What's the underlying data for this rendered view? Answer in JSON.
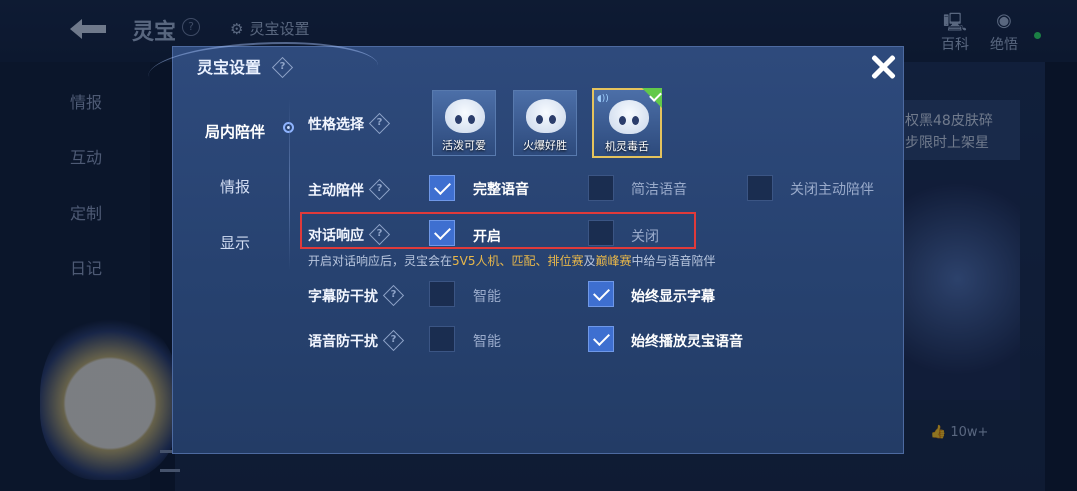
{
  "background": {
    "title": "灵宝",
    "help": "?",
    "settings_link": "灵宝设置",
    "right_buttons": [
      {
        "label": "百科",
        "icon": "computer-icon"
      },
      {
        "label": "绝悟",
        "icon": "wisdom-icon"
      }
    ],
    "sidebar": [
      "情报",
      "互动",
      "定制",
      "日记"
    ],
    "banner_text_line1": "权黑48皮肤碎",
    "banner_text_line2": "步限时上架星",
    "like_count": "10w+"
  },
  "dialog": {
    "title": "灵宝设置",
    "tabs": [
      "局内陪伴",
      "情报",
      "显示"
    ],
    "active_tab": "局内陪伴",
    "personality": {
      "label": "性格选择",
      "options": [
        {
          "caption": "活泼可爱",
          "selected": false
        },
        {
          "caption": "火爆好胜",
          "selected": false
        },
        {
          "caption": "机灵毒舌",
          "selected": true
        }
      ]
    },
    "active_companion": {
      "label": "主动陪伴",
      "options": [
        {
          "label": "完整语音",
          "checked": true
        },
        {
          "label": "简洁语音",
          "checked": false
        },
        {
          "label": "关闭主动陪伴",
          "checked": false
        }
      ]
    },
    "dialogue_response": {
      "label": "对话响应",
      "options": [
        {
          "label": "开启",
          "checked": true
        },
        {
          "label": "关闭",
          "checked": false
        }
      ]
    },
    "note": {
      "prefix": "开启对话响应后，灵宝会在",
      "hl1": "5V5人机、匹配、排位赛",
      "mid": "及",
      "hl2": "巅峰赛",
      "suffix": "中给与语音陪伴"
    },
    "subtitle_anti_interference": {
      "label": "字幕防干扰",
      "options": [
        {
          "label": "智能",
          "checked": false
        },
        {
          "label": "始终显示字幕",
          "checked": true
        }
      ]
    },
    "voice_anti_interference": {
      "label": "语音防干扰",
      "options": [
        {
          "label": "智能",
          "checked": false
        },
        {
          "label": "始终播放灵宝语音",
          "checked": true
        }
      ]
    }
  },
  "colors": {
    "accent": "#3e6fd0",
    "highlight_border": "#e03a3a",
    "note_highlight": "#e8b74a",
    "selected_border": "#e5c35d"
  }
}
